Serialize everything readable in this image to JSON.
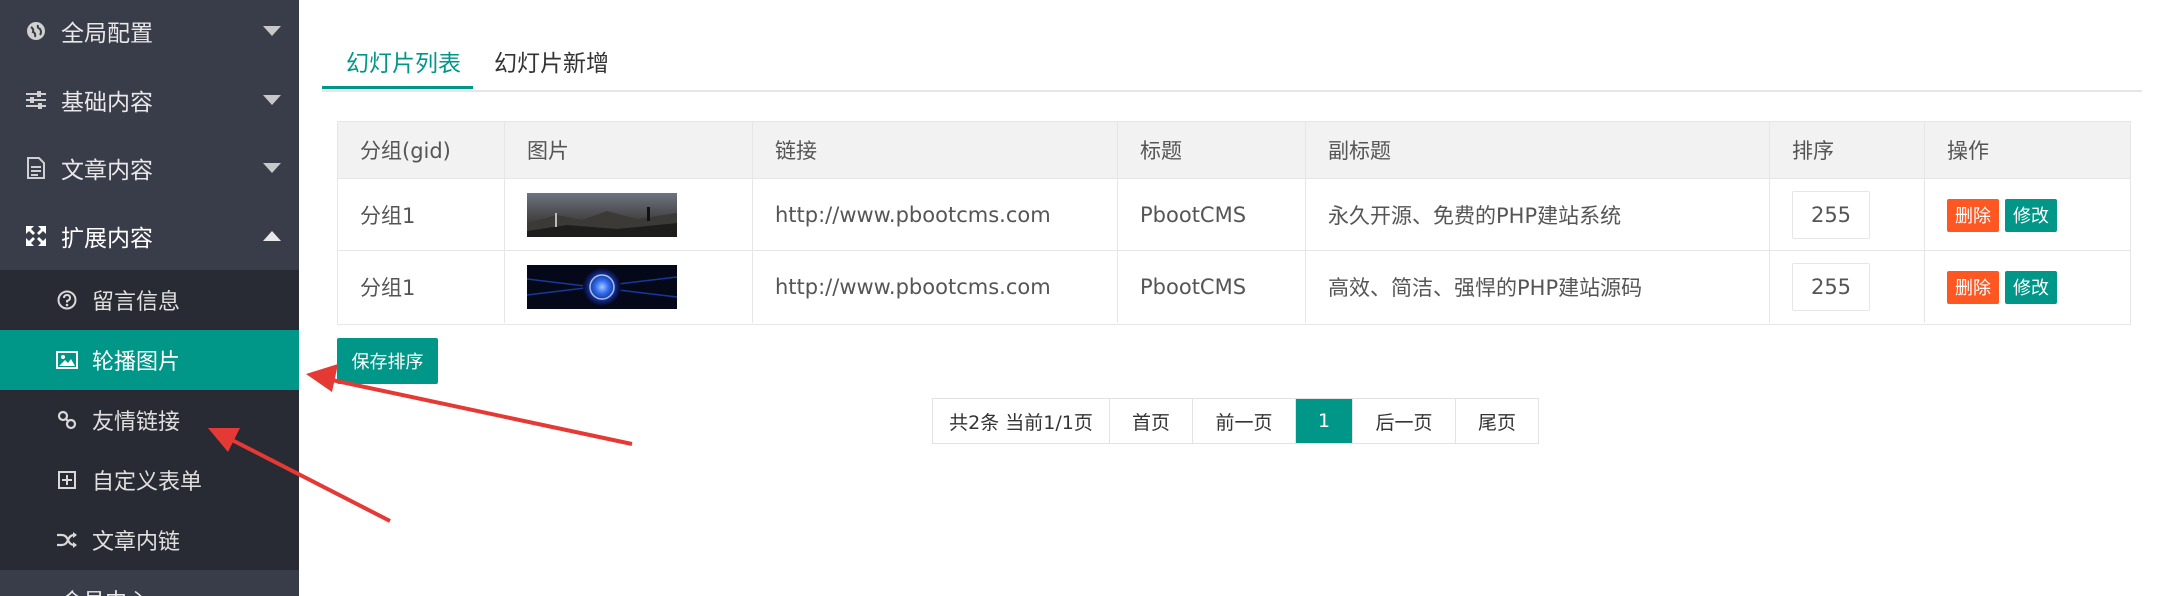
{
  "sidebar": {
    "items": [
      {
        "label": "全局配置",
        "icon": "globe-icon",
        "expanded": false
      },
      {
        "label": "基础内容",
        "icon": "sliders-icon",
        "expanded": false
      },
      {
        "label": "文章内容",
        "icon": "document-icon",
        "expanded": false
      },
      {
        "label": "扩展内容",
        "icon": "expand-icon",
        "expanded": true
      }
    ],
    "submenu": [
      {
        "label": "留言信息",
        "icon": "question-circle-icon",
        "active": false
      },
      {
        "label": "轮播图片",
        "icon": "image-icon",
        "active": true
      },
      {
        "label": "友情链接",
        "icon": "link-icon",
        "active": false
      },
      {
        "label": "自定义表单",
        "icon": "plus-square-icon",
        "active": false
      },
      {
        "label": "文章内链",
        "icon": "shuffle-icon",
        "active": false
      }
    ],
    "bottom_label": "会员中心"
  },
  "tabs": {
    "list_label": "幻灯片列表",
    "add_label": "幻灯片新增"
  },
  "table": {
    "headers": [
      "分组(gid)",
      "图片",
      "链接",
      "标题",
      "副标题",
      "排序",
      "操作"
    ],
    "rows": [
      {
        "group": "分组1",
        "image": "mountain-photo",
        "link": "http://www.pbootcms.com",
        "title": "PbootCMS",
        "subtitle": "永久开源、免费的PHP建站系统",
        "sort": "255"
      },
      {
        "group": "分组1",
        "image": "blue-orb-photo",
        "link": "http://www.pbootcms.com",
        "title": "PbootCMS",
        "subtitle": "高效、简洁、强悍的PHP建站源码",
        "sort": "255"
      }
    ],
    "delete_label": "删除",
    "edit_label": "修改"
  },
  "save_sort_label": "保存排序",
  "pagination": {
    "summary": "共2条 当前1/1页",
    "first": "首页",
    "prev": "前一页",
    "current": "1",
    "next": "后一页",
    "last": "尾页"
  },
  "colors": {
    "sidebar_bg": "#393D49",
    "submenu_bg": "#282B33",
    "accent": "#009688",
    "danger": "#FF5722",
    "arrow": "#E53935"
  }
}
